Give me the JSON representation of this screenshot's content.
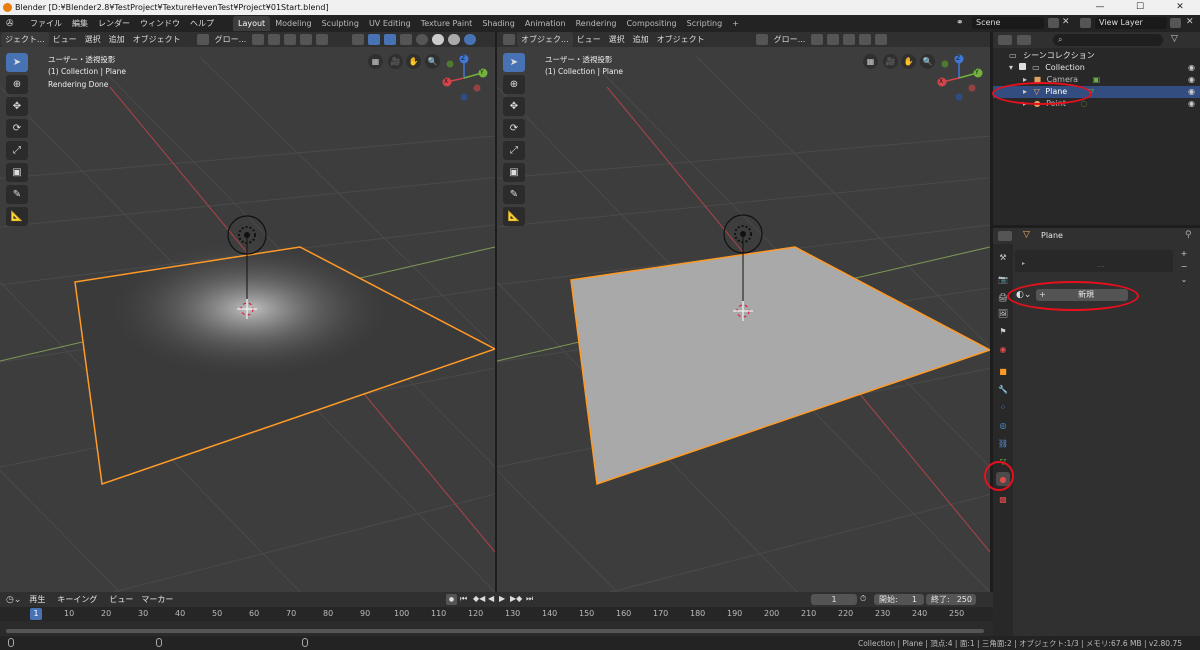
{
  "window": {
    "title": "Blender [D:¥Blender2.8¥TestProject¥TextureHevenTest¥Project¥01Start.blend]",
    "min": "—",
    "max": "☐",
    "close": "✕"
  },
  "menus": [
    "ファイル",
    "編集",
    "レンダー",
    "ウィンドウ",
    "ヘルプ"
  ],
  "workspaces": [
    {
      "label": "Layout",
      "active": true
    },
    {
      "label": "Modeling"
    },
    {
      "label": "Sculpting"
    },
    {
      "label": "UV Editing"
    },
    {
      "label": "Texture Paint"
    },
    {
      "label": "Shading"
    },
    {
      "label": "Animation"
    },
    {
      "label": "Rendering"
    },
    {
      "label": "Compositing"
    },
    {
      "label": "Scripting"
    }
  ],
  "add_workspace": "+",
  "scene": {
    "label": "Scene",
    "view_layer": "View Layer"
  },
  "viewport_left": {
    "mode": "ジェクト...",
    "menus": [
      "ビュー",
      "選択",
      "追加",
      "オブジェクト"
    ],
    "orientation": "グロー...",
    "view_name": "ユーザー・透視投影",
    "collection_info": "(1) Collection | Plane",
    "status": "Rendering Done"
  },
  "viewport_right": {
    "mode": "オブジェク...",
    "menus": [
      "ビュー",
      "選択",
      "追加",
      "オブジェクト"
    ],
    "orientation": "グロー...",
    "view_name": "ユーザー・透視投影",
    "collection_info": "(1) Collection | Plane"
  },
  "gizmo": {
    "x": "X",
    "y": "Y",
    "z": "Z"
  },
  "outliner": {
    "root": "シーンコレクション",
    "collection": "Collection",
    "items": [
      "Camera",
      "Plane",
      "Point"
    ]
  },
  "properties": {
    "object_name": "Plane",
    "dots": "....",
    "new_button": "新規",
    "plus": "+",
    "minus": "−"
  },
  "timeline": {
    "menus": [
      "再生",
      "キーイング",
      "ビュー",
      "マーカー"
    ],
    "current_frame": "1",
    "start_label": "開始:",
    "start": "1",
    "end_label": "終了:",
    "end": "250",
    "ruler": [
      "1",
      "10",
      "20",
      "30",
      "40",
      "50",
      "60",
      "70",
      "80",
      "90",
      "100",
      "110",
      "120",
      "130",
      "140",
      "150",
      "160",
      "170",
      "180",
      "190",
      "200",
      "210",
      "220",
      "230",
      "240",
      "250"
    ]
  },
  "statusbar": {
    "info": "Collection | Plane | 頂点:4 | 面:1 | 三角面:2 | オブジェクト:1/3 | メモリ:67.6 MB | v2.80.75"
  },
  "colors": {
    "accent": "#4772b3",
    "selection": "#ff9a27",
    "highlight": "#e8101c"
  }
}
